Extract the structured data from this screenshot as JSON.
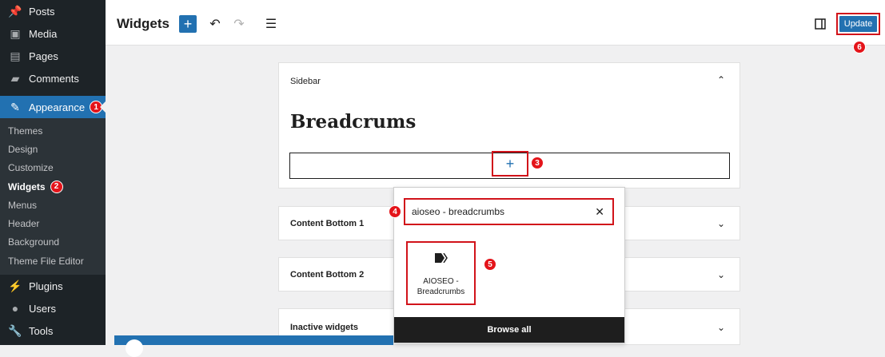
{
  "sidebar": {
    "items_top": [
      {
        "label": "Posts",
        "icon": "pin-icon"
      },
      {
        "label": "Media",
        "icon": "media-icon"
      },
      {
        "label": "Pages",
        "icon": "pages-icon"
      },
      {
        "label": "Comments",
        "icon": "comments-icon"
      }
    ],
    "appearance": {
      "label": "Appearance",
      "badge": "1"
    },
    "submenu": [
      "Themes",
      "Design",
      "Customize",
      "Widgets",
      "Menus",
      "Header",
      "Background",
      "Theme File Editor"
    ],
    "widgets_badge": "2",
    "items_bottom": [
      {
        "label": "Plugins",
        "icon": "plugins-icon"
      },
      {
        "label": "Users",
        "icon": "users-icon"
      },
      {
        "label": "Tools",
        "icon": "tools-icon"
      }
    ]
  },
  "topbar": {
    "title": "Widgets",
    "add_label": "+",
    "update_label": "Update",
    "update_badge": "6"
  },
  "panels": {
    "sidebar_title": "Sidebar",
    "heading": "Breadcrums",
    "appender_plus": "+",
    "appender_badge": "3",
    "content_bottom_1": "Content Bottom 1",
    "content_bottom_2": "Content Bottom 2",
    "inactive": "Inactive widgets"
  },
  "inserter": {
    "search_value": "aioseo - breadcrumbs",
    "search_badge": "4",
    "result_label": "AIOSEO - Breadcrumbs",
    "result_badge": "5",
    "browse_all": "Browse all"
  },
  "colors": {
    "accent": "#2271b1",
    "badge": "#e4141a",
    "highlight_border": "#d1131a",
    "sidebar_bg": "#1d2327"
  }
}
